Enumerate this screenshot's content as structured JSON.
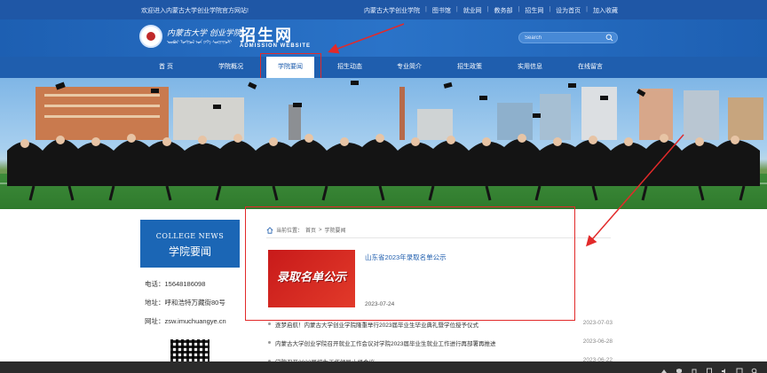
{
  "topbar": {
    "welcome": "欢迎进入内蒙古大学创业学院官方网站!",
    "links": [
      "内蒙古大学创业学院",
      "图书馆",
      "就业网",
      "教务部",
      "招生网",
      "设为首页",
      "加入收藏"
    ]
  },
  "header": {
    "school_name": "内蒙古大学 创业学院",
    "school_sub": "ᠦᠪᠦᠷ ᠮᠣᠩᠭᠣᠯ ᠤᠨ ᠶᠡᠬᠡ ᠰᠤᠷᠭᠠᠭᠤᠯᠢ",
    "site_title": "招生网",
    "site_subtitle": "ADMISSION WEBSITE",
    "search_placeholder": "Search"
  },
  "nav": {
    "items": [
      "首 页",
      "学院概况",
      "学院要闻",
      "招生动态",
      "专业简介",
      "招生政策",
      "实用信息",
      "在线留言"
    ],
    "active_index": 2
  },
  "sidebar": {
    "title_en": "COLLEGE NEWS",
    "title_cn": "学院要闻",
    "phone": "电话：15648186098",
    "address": "地址：呼和浩特万藏街80号",
    "website": "网址：zsw.imuchuangye.cn"
  },
  "breadcrumb": {
    "prefix": "当前位置：",
    "home": "首页",
    "sep": ">",
    "current": "学院要闻"
  },
  "featured": {
    "thumb_text": "录取名单公示",
    "title": "山东省2023年录取名单公示",
    "date": "2023-07-24"
  },
  "news_list": [
    {
      "title": "逐梦启航！内蒙古大学创业学院隆重举行2023届毕业生毕业典礼暨学位授予仪式",
      "date": "2023-07-03"
    },
    {
      "title": "内蒙古大学创业学院召开就业工作会议对学院2023届毕业生就业工作进行再部署再推进",
      "date": "2023-06-28"
    },
    {
      "title": "学院召开2023届招生工作领导小组会议",
      "date": "2023-06-22"
    }
  ],
  "colors": {
    "brand_blue": "#1f5eae",
    "highlight_red": "#e22a2a"
  }
}
